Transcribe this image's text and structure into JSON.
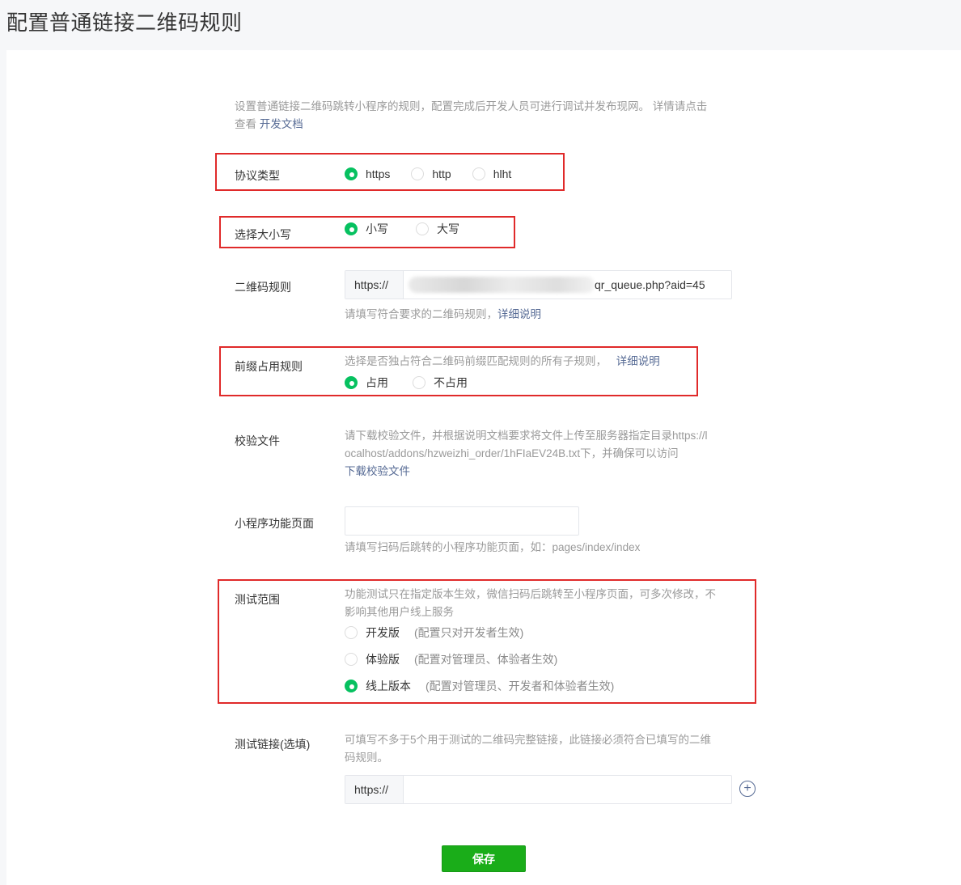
{
  "page_title": "配置普通链接二维码规则",
  "intro": {
    "text": "设置普通链接二维码跳转小程序的规则，配置完成后开发人员可进行调试并发布现网。 详情请点击",
    "text2": "查看",
    "link": "开发文档"
  },
  "protocol": {
    "label": "协议类型",
    "options": [
      "https",
      "http",
      "hlht"
    ],
    "selected": "https"
  },
  "case": {
    "label": "选择大小写",
    "options": [
      "小写",
      "大写"
    ],
    "selected": "小写"
  },
  "qr_rule": {
    "label": "二维码规则",
    "prefix": "https://",
    "value_suffix": "qr_queue.php?aid=45",
    "hint": "请填写符合要求的二维码规则，",
    "hint_link": "详细说明"
  },
  "prefix_rule": {
    "label": "前缀占用规则",
    "desc": "选择是否独占符合二维码前缀匹配规则的所有子规则，",
    "desc_link": "详细说明",
    "options": [
      "占用",
      "不占用"
    ],
    "selected": "占用"
  },
  "verify_file": {
    "label": "校验文件",
    "desc_line1": "请下载校验文件，并根据说明文档要求将文件上传至服务器指定目录https://l",
    "desc_line2": "ocalhost/addons/hzweizhi_order/1hFIaEV24B.txt下，并确保可以访问",
    "download_link": "下载校验文件"
  },
  "mp_page": {
    "label": "小程序功能页面",
    "value": "",
    "hint": "请填写扫码后跳转的小程序功能页面，如：pages/index/index"
  },
  "test_scope": {
    "label": "测试范围",
    "desc_line1": "功能测试只在指定版本生效，微信扫码后跳转至小程序页面，可多次修改，不",
    "desc_line2": "影响其他用户线上服务",
    "options": [
      {
        "name": "开发版",
        "note": "(配置只对开发者生效)"
      },
      {
        "name": "体验版",
        "note": "(配置对管理员、体验者生效)"
      },
      {
        "name": "线上版本",
        "note": "(配置对管理员、开发者和体验者生效)"
      }
    ],
    "selected": "线上版本"
  },
  "test_link": {
    "label": "测试链接(选填)",
    "desc_line1": "可填写不多于5个用于测试的二维码完整链接，此链接必须符合已填写的二维",
    "desc_line2": "码规则。",
    "prefix": "https://",
    "value": "",
    "add_icon": "plus-circle-icon"
  },
  "save_label": "保存",
  "colors": {
    "accent": "#07c160",
    "button": "#1aad19",
    "link": "#576b95",
    "highlight_box": "#e02a2a"
  }
}
